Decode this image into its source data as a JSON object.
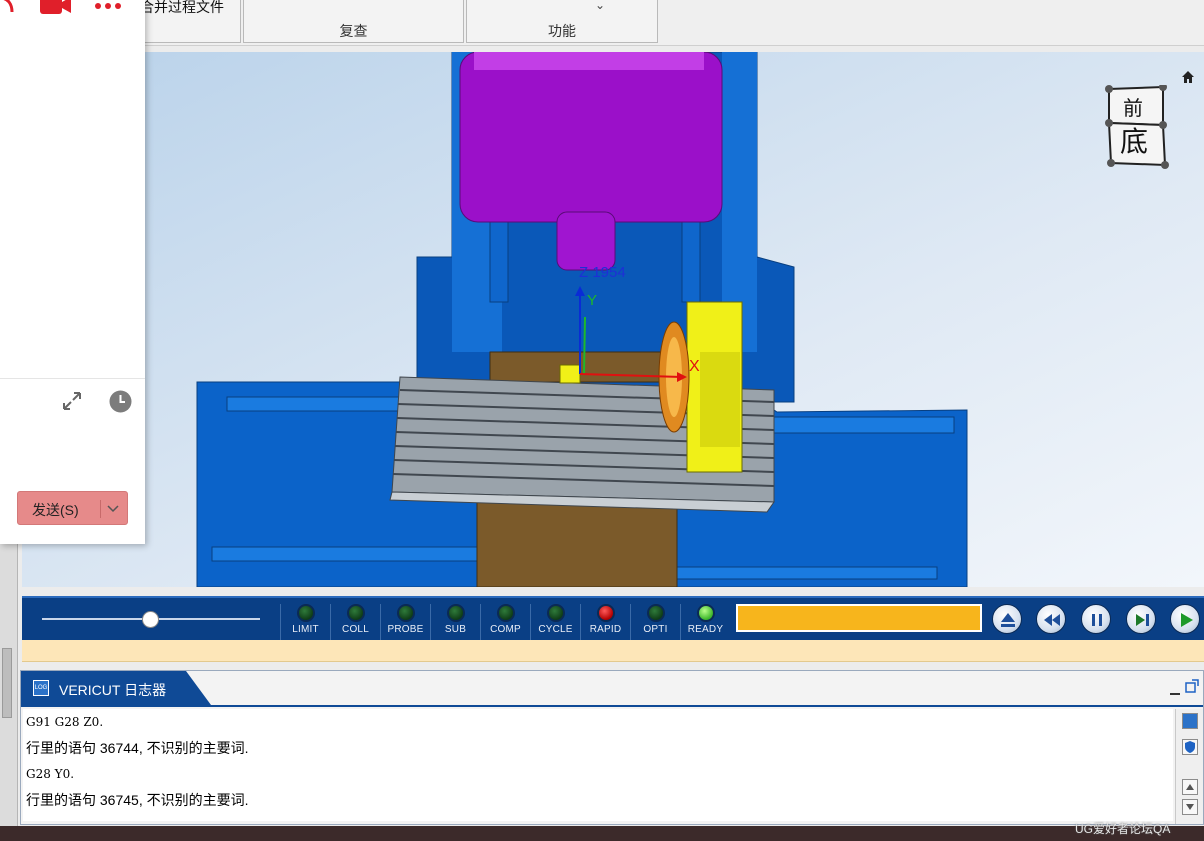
{
  "ribbon": {
    "merge_label": "合并过程文件",
    "group_review": "复查",
    "group_function": "功能"
  },
  "viewport": {
    "cube_front": "前",
    "cube_bottom": "底",
    "axis_z_label": "Z 1954",
    "axis_y": "Y",
    "axis_x": "X"
  },
  "controls": {
    "slider_fraction": 0.5,
    "leds": [
      {
        "label": "LIMIT",
        "state": "off"
      },
      {
        "label": "COLL",
        "state": "off"
      },
      {
        "label": "PROBE",
        "state": "off"
      },
      {
        "label": "SUB",
        "state": "off"
      },
      {
        "label": "COMP",
        "state": "off"
      },
      {
        "label": "CYCLE",
        "state": "off"
      },
      {
        "label": "RAPID",
        "state": "red"
      },
      {
        "label": "OPTI",
        "state": "off"
      },
      {
        "label": "READY",
        "state": "green"
      }
    ]
  },
  "logger": {
    "title": "VERICUT 日志器",
    "tab_icon": "LOG",
    "lines": [
      "G91 G28 Z0.",
      "行里的语句 36744, 不识别的主要词.",
      "G28 Y0.",
      "行里的语句 36745, 不识别的主要词."
    ]
  },
  "chat": {
    "send_label": "发送(S)"
  },
  "watermark": "UG爱好者论坛QA"
}
